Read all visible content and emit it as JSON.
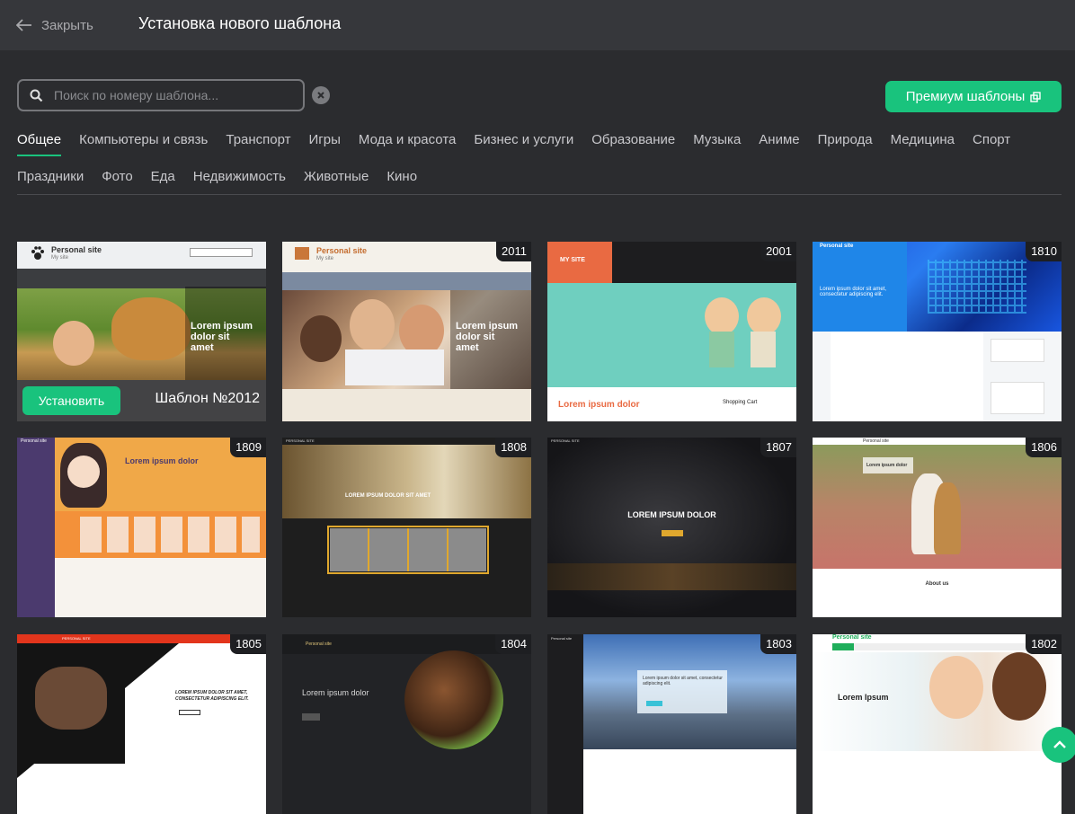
{
  "header": {
    "close_label": "Закрыть",
    "title": "Установка нового шаблона"
  },
  "search": {
    "placeholder": "Поиск по номеру шаблона..."
  },
  "premium_button": "Премиум шаблоны",
  "categories_row1": [
    "Общее",
    "Компьютеры и связь",
    "Транспорт",
    "Игры",
    "Мода и красота",
    "Бизнес и услуги",
    "Образование",
    "Музыка",
    "Аниме",
    "Природа",
    "Медицина",
    "Спорт"
  ],
  "categories_row2": [
    "Праздники",
    "Фото",
    "Еда",
    "Недвижимость",
    "Животные",
    "Кино"
  ],
  "active_category": "Общее",
  "install_label": "Установить",
  "templates": [
    {
      "number": "2012",
      "hover_label": "Шаблон №2012",
      "site_title": "Personal site",
      "site_sub": "My site",
      "lorem": "Lorem ipsum dolor sit amet"
    },
    {
      "number": "2011",
      "site_title": "Personal site",
      "site_sub": "My site",
      "lorem": "Lorem ipsum dolor sit amet"
    },
    {
      "number": "2001",
      "site_title": "MY SITE",
      "lorem": "Lorem ipsum dolor",
      "side": "Shopping Cart"
    },
    {
      "number": "1810",
      "site_title": "Personal site",
      "lorem": "Lorem ipsum dolor sit amet, consectetur adipiscing elit."
    },
    {
      "number": "1809",
      "site_title": "Personal site",
      "lorem": "Lorem ipsum dolor"
    },
    {
      "number": "1808",
      "site_title": "PERSONAL SITE",
      "lorem": "LOREM IPSUM DOLOR SIT AMET"
    },
    {
      "number": "1807",
      "site_title": "PERSONAL SITE",
      "lorem": "LOREM IPSUM DOLOR"
    },
    {
      "number": "1806",
      "site_title": "Personal site",
      "lorem": "Lorem ipsum dolor",
      "footer": "About us"
    },
    {
      "number": "1805",
      "site_title": "PERSONAL SITE",
      "lorem": "LOREM IPSUM DOLOR SIT AMET, CONSECTETUR ADIPISCING ELIT."
    },
    {
      "number": "1804",
      "site_title": "Personal site",
      "lorem": "Lorem ipsum dolor"
    },
    {
      "number": "1803",
      "site_title": "Personal site",
      "lorem": "Lorem ipsum dolor sit amet, consectetur adipiscing elit."
    },
    {
      "number": "1802",
      "site_title": "Personal site",
      "lorem": "Lorem Ipsum"
    }
  ],
  "colors": {
    "accent": "#19c37d",
    "background": "#2b2c2f",
    "topbar": "#36373b"
  }
}
